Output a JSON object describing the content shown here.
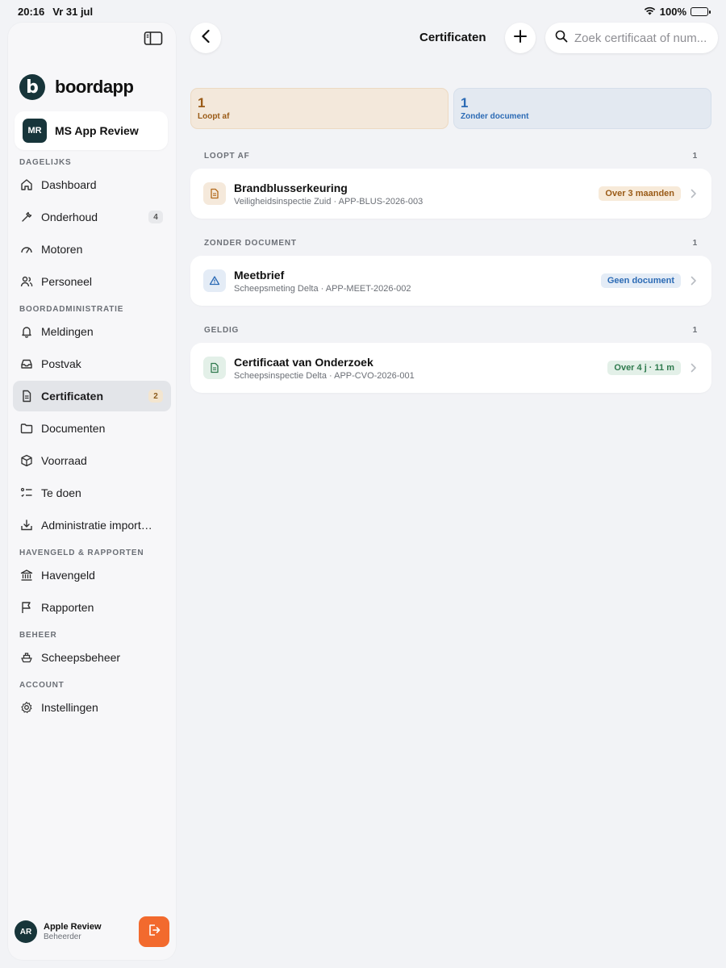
{
  "status_bar": {
    "time": "20:16",
    "date": "Vr 31 jul",
    "battery": "100%"
  },
  "sidebar": {
    "brand": "boordapp",
    "brand_letter": "b",
    "account": {
      "initials": "MR",
      "name": "MS App Review"
    },
    "sections": {
      "dagelijks": "DAGELIJKS",
      "boordadministratie": "BOORDADMINISTRATIE",
      "havengeld": "HAVENGELD & RAPPORTEN",
      "beheer": "BEHEER",
      "account": "ACCOUNT"
    },
    "items": {
      "dashboard": {
        "label": "Dashboard",
        "icon": "home-icon"
      },
      "onderhoud": {
        "label": "Onderhoud",
        "icon": "wrench-icon",
        "badge": "4"
      },
      "motoren": {
        "label": "Motoren",
        "icon": "gauge-icon"
      },
      "personeel": {
        "label": "Personeel",
        "icon": "users-icon"
      },
      "meldingen": {
        "label": "Meldingen",
        "icon": "bell-icon"
      },
      "postvak": {
        "label": "Postvak",
        "icon": "inbox-icon"
      },
      "certificaten": {
        "label": "Certificaten",
        "icon": "document-icon",
        "badge": "2"
      },
      "documenten": {
        "label": "Documenten",
        "icon": "folder-icon"
      },
      "voorraad": {
        "label": "Voorraad",
        "icon": "box-icon"
      },
      "te_doen": {
        "label": "Te doen",
        "icon": "checklist-icon"
      },
      "administratie": {
        "label": "Administratie import…",
        "icon": "import-icon"
      },
      "havengeld": {
        "label": "Havengeld",
        "icon": "bank-icon"
      },
      "rapporten": {
        "label": "Rapporten",
        "icon": "flag-icon"
      },
      "scheepsbeheer": {
        "label": "Scheepsbeheer",
        "icon": "ship-icon"
      },
      "instellingen": {
        "label": "Instellingen",
        "icon": "gear-icon"
      }
    },
    "user": {
      "initials": "AR",
      "name": "Apple Review",
      "role": "Beheerder"
    }
  },
  "header": {
    "title": "Certificaten",
    "search_placeholder": "Zoek certificaat of num..."
  },
  "summary": [
    {
      "count": "1",
      "label": "Loopt af",
      "color": "#9a5b17"
    },
    {
      "count": "1",
      "label": "Zonder document",
      "color": "#2c6bb5"
    }
  ],
  "sections": [
    {
      "title": "LOOPT AF",
      "count": "1",
      "items": [
        {
          "title": "Brandblusserkeuring",
          "subtitle": "Veiligheidsinspectie Zuid · APP-BLUS-2026-003",
          "status": "Over 3 maanden",
          "icon": "document-icon"
        }
      ]
    },
    {
      "title": "ZONDER DOCUMENT",
      "count": "1",
      "items": [
        {
          "title": "Meetbrief",
          "subtitle": "Scheepsmeting Delta · APP-MEET-2026-002",
          "status": "Geen document",
          "icon": "warning-icon"
        }
      ]
    },
    {
      "title": "GELDIG",
      "count": "1",
      "items": [
        {
          "title": "Certificaat van Onderzoek",
          "subtitle": "Scheepsinspectie Delta · APP-CVO-2026-001",
          "status": "Over 4 j · 11 m",
          "icon": "document-icon"
        }
      ]
    }
  ]
}
